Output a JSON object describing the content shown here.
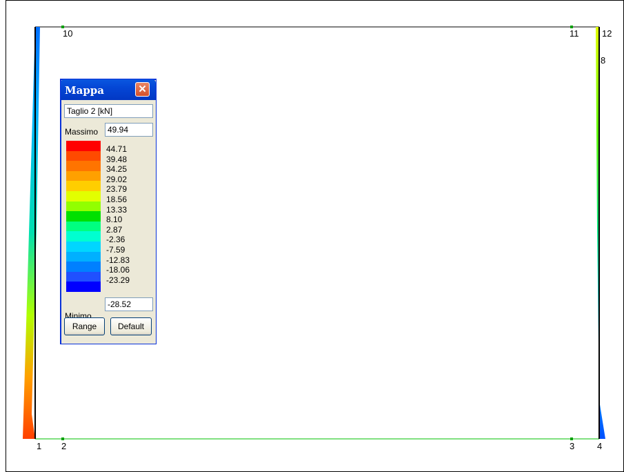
{
  "window": {
    "title": "Mappa",
    "field": "Taglio 2 [kN]",
    "max_label": "Massimo",
    "max_value": "49.94",
    "min_label": "Minimo",
    "min_value": "-28.52",
    "range_button": "Range",
    "default_button": "Default"
  },
  "scale": {
    "values": [
      "44.71",
      "39.48",
      "34.25",
      "29.02",
      "23.79",
      "18.56",
      "13.33",
      "8.10",
      "2.87",
      "-2.36",
      "-7.59",
      "-12.83",
      "-18.06",
      "-23.29"
    ],
    "colors": [
      "#ff0000",
      "#ff4a00",
      "#ff7400",
      "#ffa000",
      "#ffce00",
      "#e2ff00",
      "#92ff00",
      "#00e000",
      "#00ff80",
      "#00ffd0",
      "#00d6ff",
      "#00b0ff",
      "#0080ff",
      "#2050ff",
      "#0000ff"
    ]
  },
  "nodes": {
    "n1": "1",
    "n2": "2",
    "n3": "3",
    "n4": "4",
    "n10": "10",
    "n11": "11",
    "n12": "12",
    "n8": "8"
  },
  "colors": {
    "frame": "#000000",
    "beam_bottom": "#00c000",
    "title_bar": "#0446d5"
  }
}
